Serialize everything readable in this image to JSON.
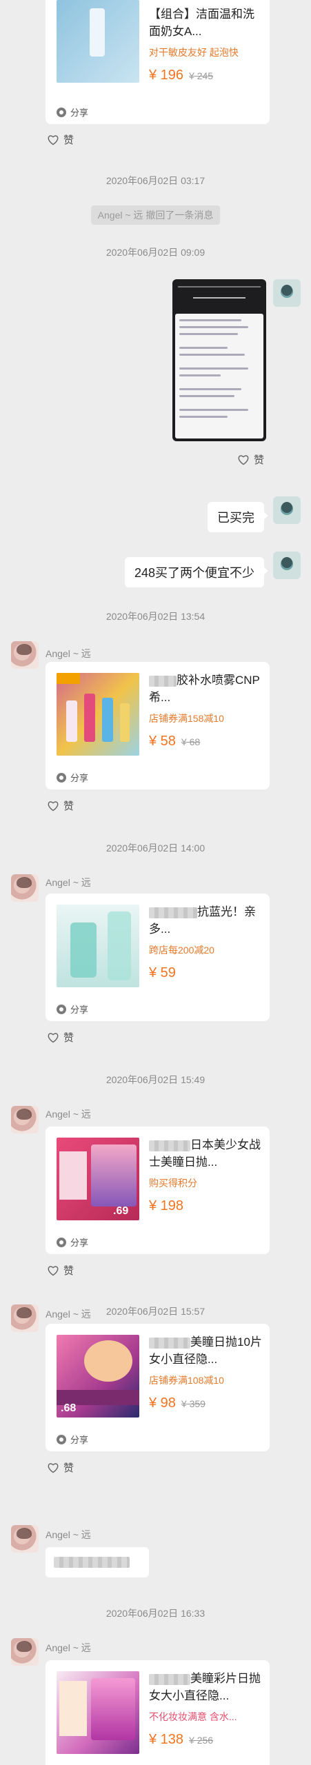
{
  "cards": [
    {
      "title": "【组合】洁面温和洗面奶女A...",
      "promo": "对干敏皮友好  起泡快",
      "price": "¥ 196",
      "orig": "¥ 245",
      "share": "分享"
    },
    {
      "title": "胶补水喷雾CNP希...",
      "promo": "店铺券满158减10",
      "price": "¥ 58",
      "orig": "¥ 68",
      "share": "分享"
    },
    {
      "title": "抗蓝光！亲多...",
      "promo": "跨店每200减20",
      "price": "¥ 59",
      "orig": "",
      "share": "分享"
    },
    {
      "title": "日本美少女战士美瞳日抛...",
      "promo": "购买得积分",
      "price": "¥ 198",
      "orig": "",
      "share": "分享"
    },
    {
      "title": "美瞳日抛10片女小直径隐...",
      "promo": "店铺券满108减10",
      "price": "¥ 98",
      "orig": "¥ 359",
      "share": "分享"
    },
    {
      "title": "美瞳彩片日抛女大小直径隐...",
      "promo": "不化妆妆满意  含水...",
      "price": "¥ 138",
      "orig": "¥ 256",
      "share": "分享"
    }
  ],
  "timestamps": [
    "2020年06月02日 03:17",
    "2020年06月02日 09:09",
    "2020年06月02日 13:54",
    "2020年06月02日 14:00",
    "2020年06月02日 15:49",
    "2020年06月02日 15:57",
    "2020年06月02日 16:33"
  ],
  "recall_notice": "Angel ~ 远 撤回了一条消息",
  "sender_name": "Angel ~ 远",
  "like_label": "赞",
  "messages": {
    "bought": "已买完",
    "bought_detail": "248买了两个便宜不少"
  },
  "thumb_labels": {
    "t4_price": ".69",
    "t5_price": ".68"
  }
}
